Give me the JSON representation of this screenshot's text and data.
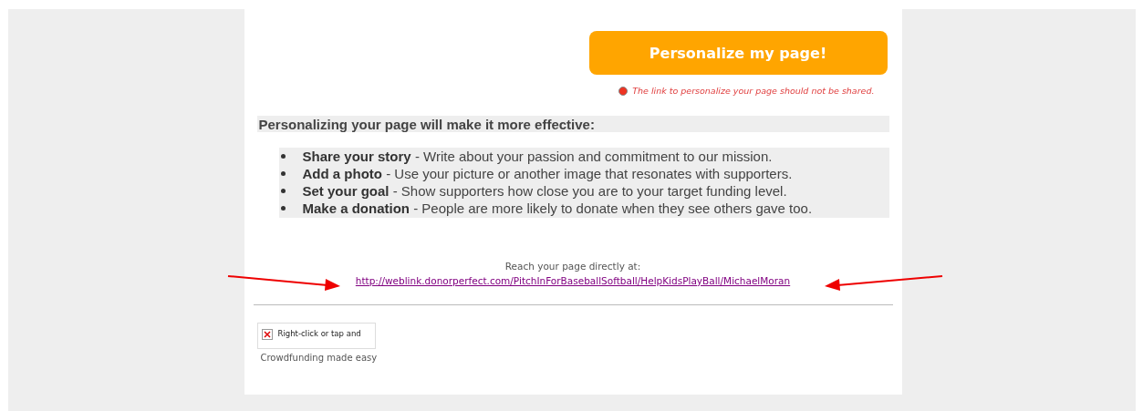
{
  "personalize_button": {
    "label": "Personalize my page!"
  },
  "warning": {
    "text": "The link to personalize your page should not be shared."
  },
  "tips": {
    "heading": "Personalizing your page will make it more effective:",
    "items": [
      {
        "text": "**Share your story** - Write about your passion and commitment to our mission."
      },
      {
        "text": "**Add a photo** - Use your picture or another image that resonates with supporters."
      },
      {
        "text": "**Set your goal** - Show supporters how close you are to your target funding level."
      },
      {
        "text": "**Make a donation** - People are more likely to donate when they see others gave too."
      }
    ]
  },
  "direct_link": {
    "label": "Reach your page directly at:",
    "url": "http://weblink.donorperfect.com/PitchInForBaseballSoftball/HelpKidsPlayBall/MichaelMoran"
  },
  "footer": {
    "image_placeholder": "Right-click or tap and",
    "caption": "Crowdfunding made easy"
  }
}
